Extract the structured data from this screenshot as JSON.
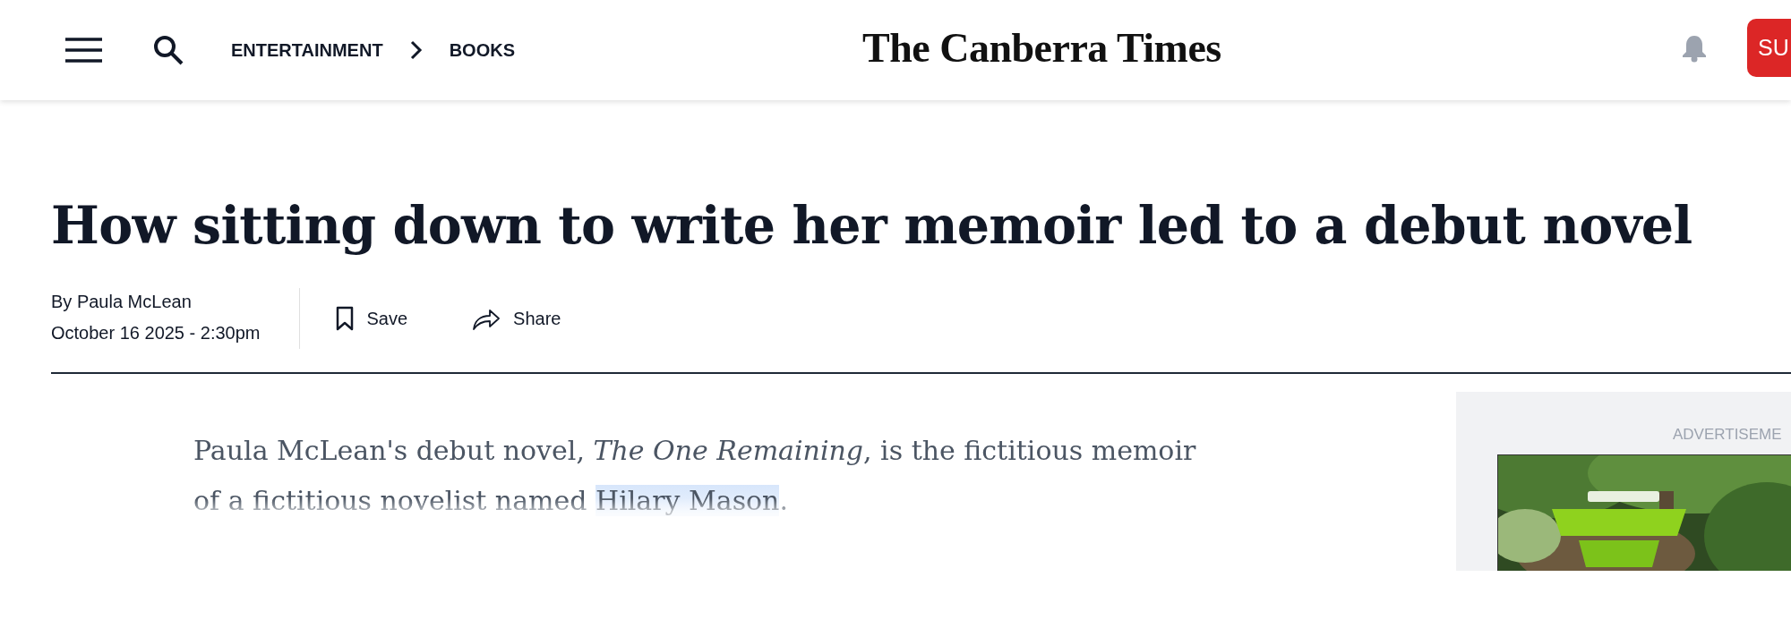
{
  "header": {
    "breadcrumbs": [
      "ENTERTAINMENT",
      "BOOKS"
    ],
    "logo": "The Canberra Times",
    "subscribe_button": "SU"
  },
  "article": {
    "headline": "How sitting down to write her memoir led to a debut novel",
    "byline": "By Paula McLean",
    "date": "October 16 2025 - 2:30pm",
    "actions": [
      {
        "kind": "save",
        "label": "Save"
      },
      {
        "kind": "share",
        "label": "Share"
      }
    ],
    "intro": [
      {
        "text": "Paula McLean's debut novel, *The One Remaining*, is the fictitious memoir of a fictitious novelist named ",
        "highlighted": false
      },
      {
        "text": "Hilary Mason",
        "highlighted": true
      },
      {
        "text": ".",
        "highlighted": false
      }
    ]
  },
  "advertisement": {
    "label": "ADVERTISEME",
    "kind": "picture"
  }
}
